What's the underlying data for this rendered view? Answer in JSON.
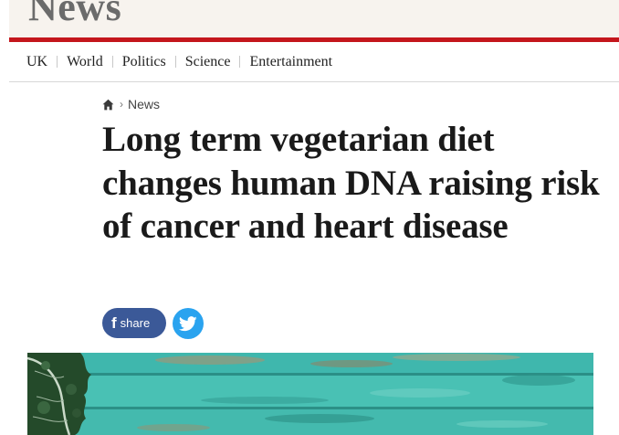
{
  "masthead": {
    "title": "News"
  },
  "nav": {
    "items": [
      "UK",
      "World",
      "Politics",
      "Science",
      "Entertainment"
    ]
  },
  "breadcrumb": {
    "home_icon": "home-icon",
    "section": "News"
  },
  "article": {
    "headline": "Long term vegetarian diet changes human DNA raising risk of cancer and heart disease"
  },
  "share": {
    "facebook_label": "share",
    "facebook_icon": "facebook-icon",
    "twitter_icon": "twitter-icon"
  },
  "colors": {
    "masthead_bg": "#f7f3ee",
    "brand_red": "#c4161c",
    "facebook_blue": "#3b5998",
    "twitter_blue": "#2aa3ef",
    "image_teal": "#3cb8ad"
  }
}
